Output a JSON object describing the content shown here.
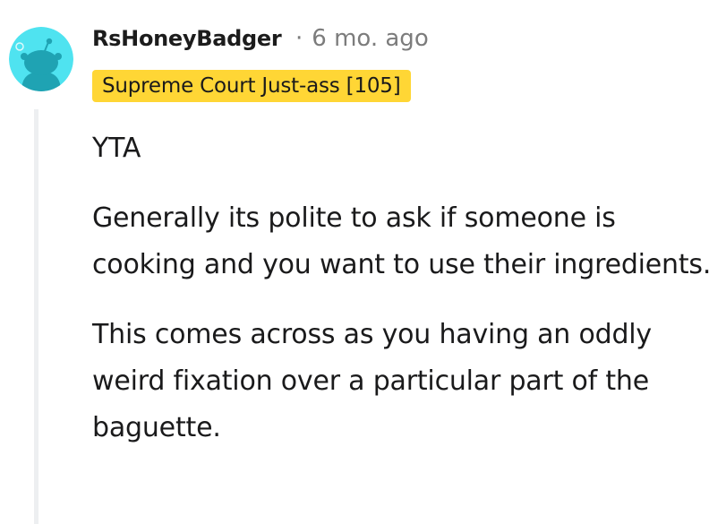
{
  "comment": {
    "author": "RsHoneyBadger",
    "separator": "·",
    "timestamp": "6 mo. ago",
    "flair": "Supreme Court Just-ass [105]",
    "paragraphs": [
      "YTA",
      "Generally its polite to ask if someone is cooking and you want to use their ingredients.",
      "This comes across as you having an oddly weird fixation over a particular part of the baguette."
    ]
  },
  "colors": {
    "avatar_background": "#4fe3f0",
    "avatar_figure": "#1fa3b3",
    "flair_background": "#ffd635",
    "thread_line": "#edeff1",
    "meta_text": "#7c7c7c"
  },
  "icons": {
    "avatar": "snoo-avatar-icon"
  }
}
